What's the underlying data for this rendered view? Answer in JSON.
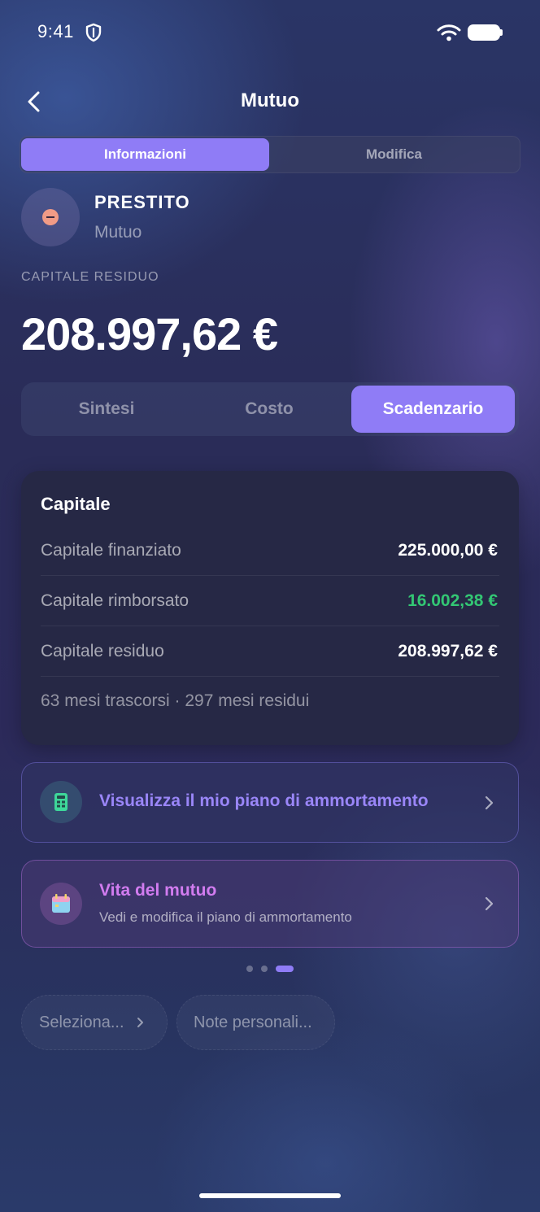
{
  "status_bar": {
    "time": "9:41"
  },
  "nav": {
    "title": "Mutuo"
  },
  "top_tabs": [
    {
      "label": "Informazioni",
      "active": true
    },
    {
      "label": "Modifica",
      "active": false
    }
  ],
  "account": {
    "name": "PRESTITO",
    "type": "Mutuo"
  },
  "capitale_residuo": {
    "label": "CAPITALE RESIDUO",
    "value": "208.997,62 €"
  },
  "section_tabs": [
    {
      "label": "Sintesi",
      "active": false
    },
    {
      "label": "Costo",
      "active": false
    },
    {
      "label": "Scadenzario",
      "active": true
    }
  ],
  "capitale_card": {
    "title": "Capitale",
    "rows": [
      {
        "label": "Capitale finanziato",
        "value": "225.000,00 €"
      },
      {
        "label": "Capitale rimborsato",
        "value": "16.002,38 €"
      },
      {
        "label": "Capitale residuo",
        "value": "208.997,62 €"
      }
    ],
    "footer": "63 mesi trascorsi · 297 mesi residui"
  },
  "actions": {
    "amortization": {
      "title": "Visualizza il mio piano di ammortamento",
      "icon": "calculator-icon"
    },
    "loan_life": {
      "title": "Vita del mutuo",
      "subtitle": "Vedi e modifica il piano di ammortamento",
      "icon": "calendar-icon"
    }
  },
  "pager": {
    "count": 3,
    "active_index": 2
  },
  "bottom_pills": {
    "select": "Seleziona...",
    "notes": "Note personali..."
  },
  "colors": {
    "accent": "#8f7cf6",
    "positive": "#33c774",
    "pink_accent": "#d27cf0",
    "card_bg": "#262845"
  }
}
